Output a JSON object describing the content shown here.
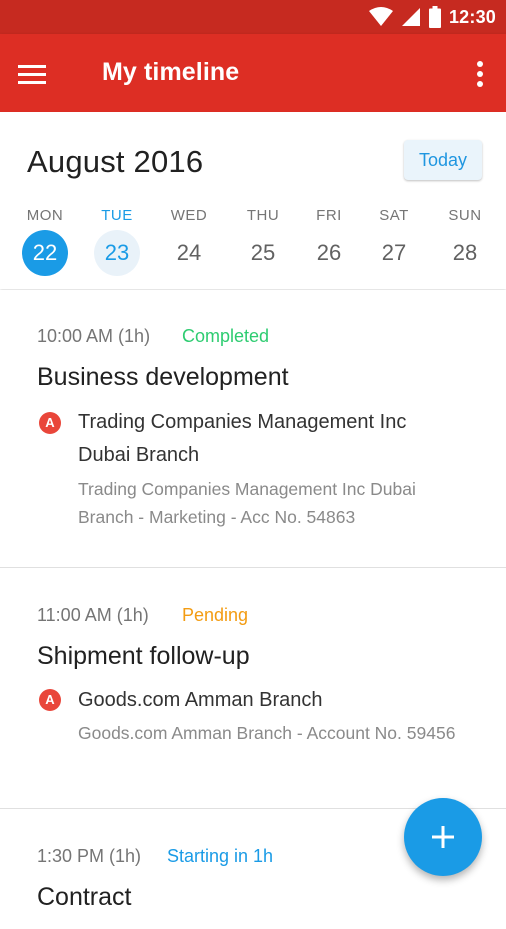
{
  "status_bar": {
    "time": "12:30",
    "icons": [
      "wifi-icon",
      "cell-signal-icon",
      "battery-icon"
    ]
  },
  "app_bar": {
    "title": "My timeline",
    "menu_icon": "hamburger-menu-icon",
    "more_icon": "more-vert-icon"
  },
  "calendar": {
    "month": "August 2016",
    "today_label": "Today",
    "days": [
      {
        "label": "MON",
        "num": "22",
        "state": "selected"
      },
      {
        "label": "TUE",
        "num": "23",
        "state": "today"
      },
      {
        "label": "WED",
        "num": "24",
        "state": ""
      },
      {
        "label": "THU",
        "num": "25",
        "state": ""
      },
      {
        "label": "FRI",
        "num": "26",
        "state": ""
      },
      {
        "label": "SAT",
        "num": "27",
        "state": ""
      },
      {
        "label": "SUN",
        "num": "28",
        "state": ""
      }
    ]
  },
  "events": [
    {
      "time": "10:00 AM (1h)",
      "status": "Completed",
      "status_color": "#2ecc71",
      "title": "Business development",
      "badge": "A",
      "company": "Trading Companies Management Inc Dubai Branch",
      "detail": "Trading Companies Management Inc Dubai Branch - Marketing - Acc No. 54863"
    },
    {
      "time": "11:00 AM (1h)",
      "status": "Pending",
      "status_color": "#f39c12",
      "title": "Shipment follow-up",
      "badge": "A",
      "company": "Goods.com Amman Branch",
      "detail": "Goods.com Amman Branch - Account No. 59456"
    },
    {
      "time": "1:30 PM (1h)",
      "status": "Starting in 1h",
      "status_color": "#1a9be6",
      "title": "Contract"
    }
  ],
  "colors": {
    "primary": "#dd2e24",
    "primary_dark": "#c62a20",
    "accent": "#1a9be6"
  },
  "fab": {
    "icon": "add-icon"
  }
}
